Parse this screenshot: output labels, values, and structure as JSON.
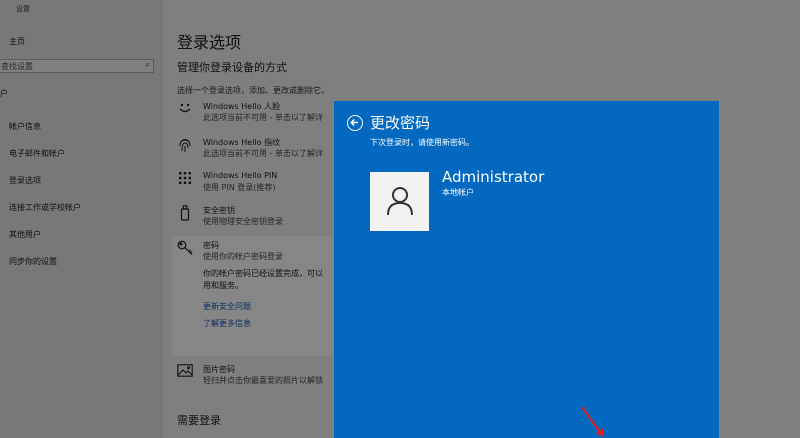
{
  "nav": {
    "app_title": "设置",
    "home": "主页",
    "search_placeholder": "查找设置",
    "section": "户",
    "items": [
      "帐户信息",
      "电子邮件和帐户",
      "登录选项",
      "连接工作或学校帐户",
      "其他用户",
      "同步你的设置"
    ]
  },
  "main": {
    "title": "登录选项",
    "subtitle": "管理你登录设备的方式",
    "hint": "选择一个登录选项，添加、更改或删除它。",
    "options": [
      {
        "icon": "face-icon",
        "title": "Windows Hello 人脸",
        "desc": "此选项当前不可用 - 单击以了解详"
      },
      {
        "icon": "fingerprint-icon",
        "title": "Windows Hello 指纹",
        "desc": "此选项当前不可用 - 单击以了解详"
      },
      {
        "icon": "pin-keypad-icon",
        "title": "Windows Hello PIN",
        "desc": "使用 PIN 登录(推荐)"
      },
      {
        "icon": "security-key-icon",
        "title": "安全密钥",
        "desc": "使用物理安全密钥登录"
      },
      {
        "icon": "key-icon",
        "title": "密码",
        "desc": "使用你的帐户密码登录"
      }
    ],
    "password_panel": {
      "text_line1": "你的帐户密码已经设置完成，可以",
      "text_line2": "用和服务。",
      "link_security_question": "更新安全问题",
      "link_learn_more": "了解更多信息"
    },
    "picture_password": {
      "icon": "picture-icon",
      "title": "图片密码",
      "desc": "轻扫并点击你最喜爱的照片以解锁"
    },
    "bottom_title": "需要登录"
  },
  "dialog": {
    "title": "更改密码",
    "subtitle": "下次登录时，请使用新密码。",
    "account_name": "Administrator",
    "account_type": "本地帐户",
    "colors": {
      "background": "#0268c0",
      "text": "#ffffff",
      "avatar_bg": "#f2f2f2"
    }
  },
  "annotation": {
    "color": "#e0201c"
  }
}
